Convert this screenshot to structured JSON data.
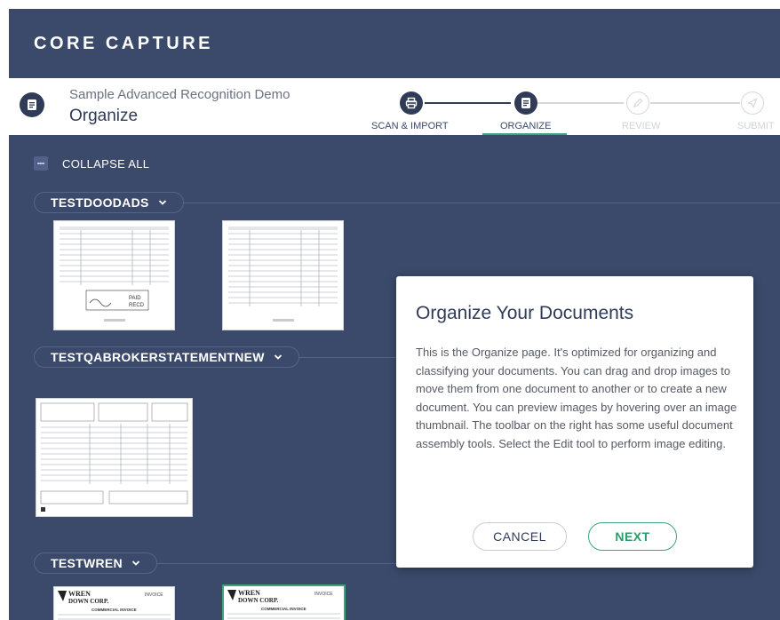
{
  "app": {
    "brand": "CORE CAPTURE"
  },
  "header": {
    "subtitle": "Sample Advanced Recognition Demo",
    "page_title": "Organize",
    "doc_icon": "document-icon"
  },
  "stepper": {
    "steps": [
      {
        "label": "SCAN & IMPORT",
        "icon": "printer-icon",
        "state": "done"
      },
      {
        "label": "ORGANIZE",
        "icon": "document-icon",
        "state": "active"
      },
      {
        "label": "REVIEW",
        "icon": "pencil-icon",
        "state": "todo"
      },
      {
        "label": "SUBMIT",
        "icon": "send-icon",
        "state": "todo"
      }
    ]
  },
  "toolbar": {
    "collapse_label": "COLLAPSE ALL"
  },
  "groups": [
    {
      "name": "TESTDOODADS",
      "page_count": 2
    },
    {
      "name": "TESTQABROKERSTATEMENTNEW",
      "page_count": 1
    },
    {
      "name": "TESTWREN",
      "page_count": 2
    }
  ],
  "thumbnails": {
    "wren_logo": "WREN",
    "wren_logo_sub": "DOWN CORP.",
    "wren_label": "INVOICE",
    "wren_sub": "COMMERCIAL INVOICE",
    "doodads_marks": [
      "PAID",
      "RECD"
    ]
  },
  "modal": {
    "title": "Organize Your Documents",
    "body": "This is the Organize page. It's optimized for organizing and classifying your documents. You can drag and drop images to move them from one document to another or to create a new document. You can preview images by hovering over an image thumbnail. The toolbar on the right has some useful document assembly tools. Select the Edit tool to perform image editing.",
    "cancel_label": "CANCEL",
    "next_label": "NEXT"
  },
  "colors": {
    "background": "#3b4a6b",
    "accent_green": "#3aa676",
    "dark_navy": "#2f3b57"
  }
}
